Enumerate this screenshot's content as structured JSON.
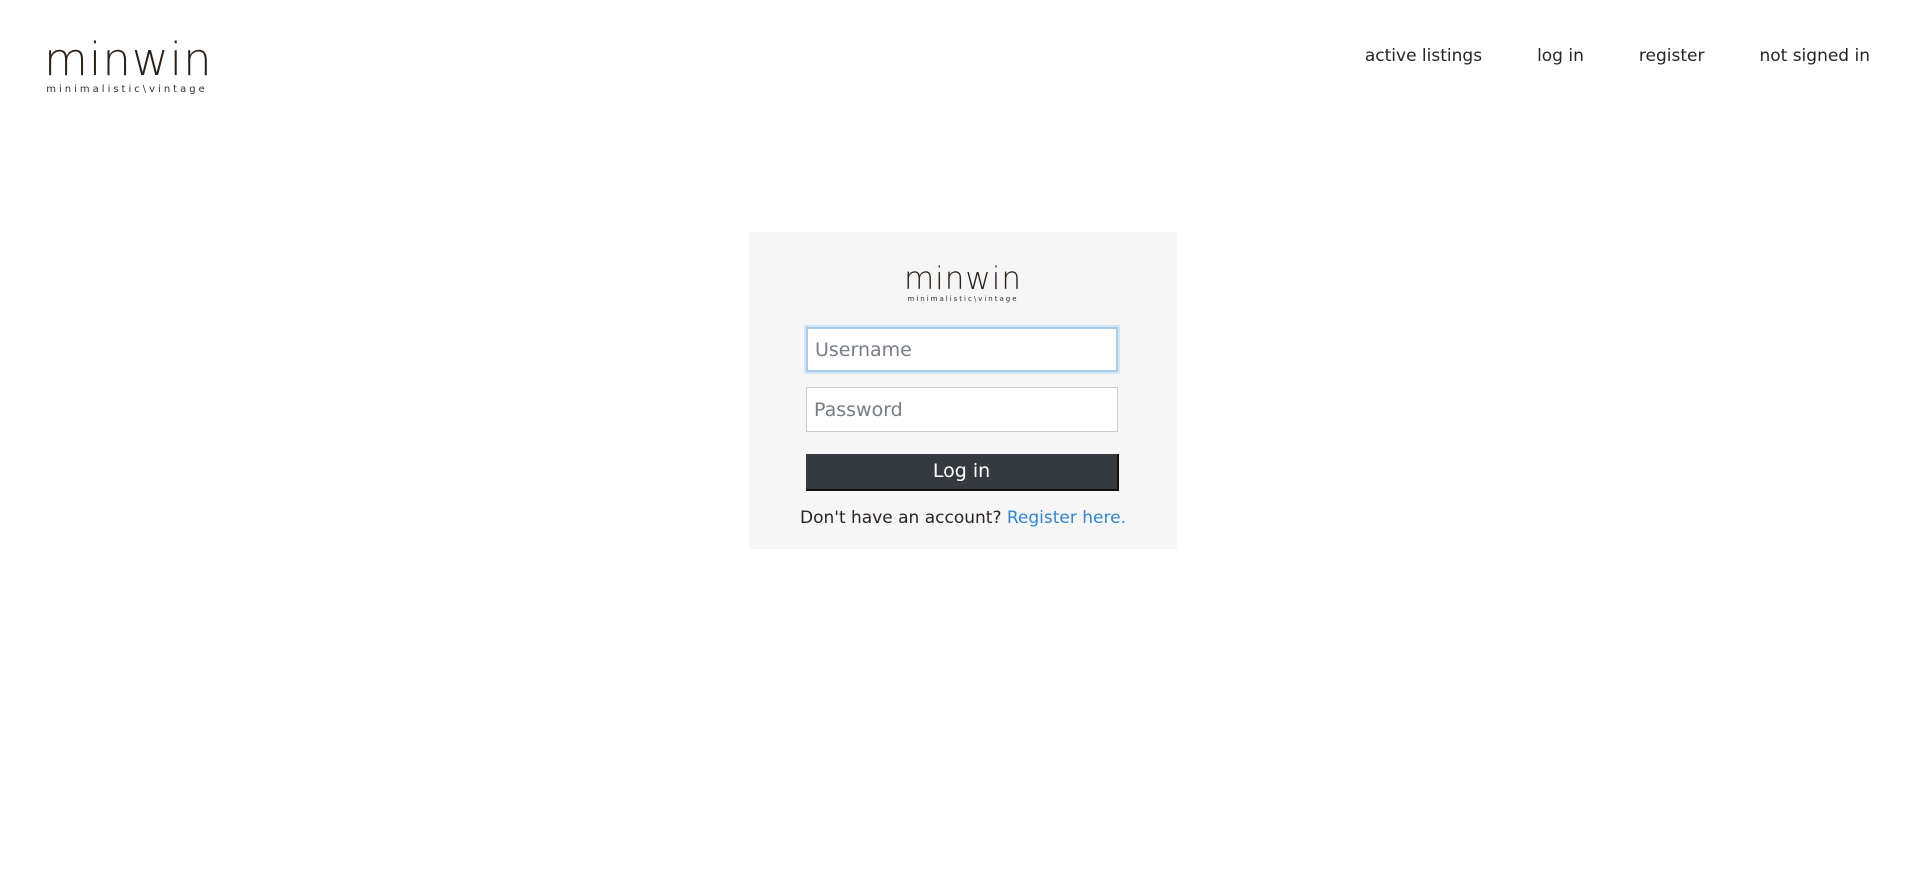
{
  "header": {
    "logo": {
      "word": "minwin",
      "tagline": "minimalistic\\vintage"
    },
    "nav": {
      "active_listings": "active listings",
      "log_in": "log in",
      "register": "register",
      "status": "not signed in"
    }
  },
  "login_card": {
    "logo": {
      "word": "minwin",
      "tagline": "minimalistic\\vintage"
    },
    "username": {
      "value": "",
      "placeholder": "Username"
    },
    "password": {
      "value": "",
      "placeholder": "Password"
    },
    "submit_label": "Log in",
    "register_prompt": "Don't have an account?",
    "register_link": "Register here."
  },
  "colors": {
    "button_bg": "#343a40",
    "link": "#2e87d8",
    "card_bg": "#f6f6f6",
    "focus_ring": "#a9cbe8"
  }
}
